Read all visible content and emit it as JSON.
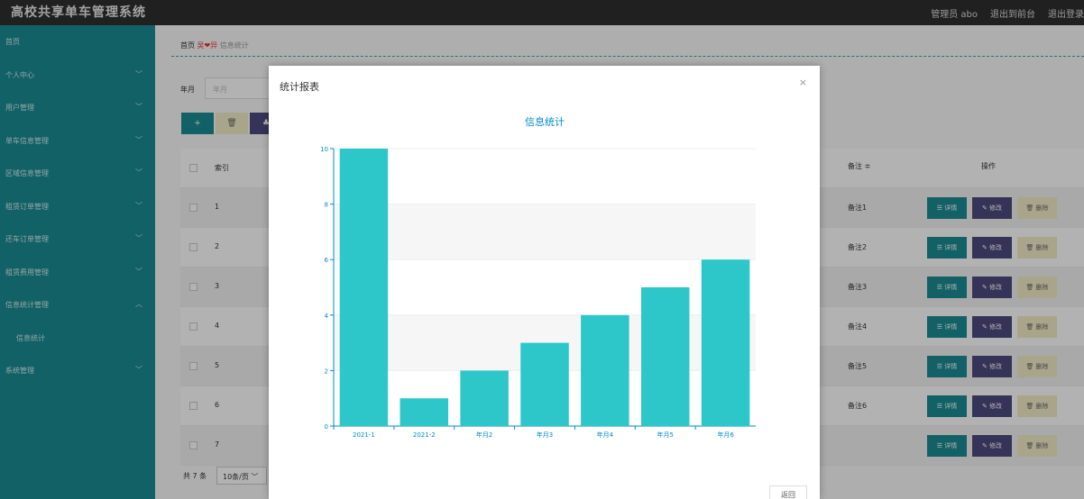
{
  "header": {
    "title": "高校共享单车管理系统",
    "user": "管理员 abo",
    "back_admin": "退出到前台",
    "logout": "退出登录"
  },
  "sidebar": {
    "items": [
      {
        "label": "首页",
        "chevron": ""
      },
      {
        "label": "个人中心",
        "chevron": "﹀"
      },
      {
        "label": "用户管理",
        "chevron": "﹀"
      },
      {
        "label": "单车信息管理",
        "chevron": "﹀"
      },
      {
        "label": "区域信息管理",
        "chevron": "﹀"
      },
      {
        "label": "租赁订单管理",
        "chevron": "﹀"
      },
      {
        "label": "还车订单管理",
        "chevron": "﹀"
      },
      {
        "label": "租赁费用管理",
        "chevron": "﹀"
      },
      {
        "label": "信息统计管理",
        "chevron": "︿"
      },
      {
        "label": "信息统计",
        "chevron": "",
        "sub": true
      },
      {
        "label": "系统管理",
        "chevron": "﹀"
      }
    ]
  },
  "breadcrumb": {
    "home": "首页",
    "sep": "吴❤异",
    "current": "信息统计"
  },
  "search": {
    "label": "年月",
    "placeholder": "年月"
  },
  "toolbar": {
    "add": "+",
    "delete": "🗑",
    "chart": "♣"
  },
  "table": {
    "headers": {
      "index": "索引",
      "note": "备注 ≑",
      "ops": "操作"
    },
    "rows": [
      {
        "index": "1",
        "note": "备注1"
      },
      {
        "index": "2",
        "note": "备注2"
      },
      {
        "index": "3",
        "note": "备注3"
      },
      {
        "index": "4",
        "note": "备注4"
      },
      {
        "index": "5",
        "note": "备注5"
      },
      {
        "index": "6",
        "note": "备注6"
      },
      {
        "index": "7",
        "note": ""
      }
    ],
    "ops": {
      "detail": "☰ 详情",
      "edit": "✎ 修改",
      "delete": "🗑 删除"
    }
  },
  "pagination": {
    "total": "共 7 条",
    "page_size": "10条/页 ﹀"
  },
  "modal": {
    "title": "统计报表",
    "close": "×",
    "back": "返回"
  },
  "chart_data": {
    "type": "bar",
    "title": "信息统计",
    "categories": [
      "2021-1",
      "2021-2",
      "年月2",
      "年月3",
      "年月4",
      "年月5",
      "年月6"
    ],
    "values": [
      10,
      1,
      2,
      3,
      4,
      5,
      6
    ],
    "ylim": [
      0,
      10
    ],
    "yticks": [
      "0",
      "2",
      "4",
      "6",
      "8",
      "10"
    ],
    "grid": true,
    "bar_color": "#2ec7c9",
    "axis_color": "#008acd"
  },
  "colors": {
    "teal": "#1a8b93",
    "purple": "#4c4a7e",
    "cream": "#f2edc8"
  }
}
